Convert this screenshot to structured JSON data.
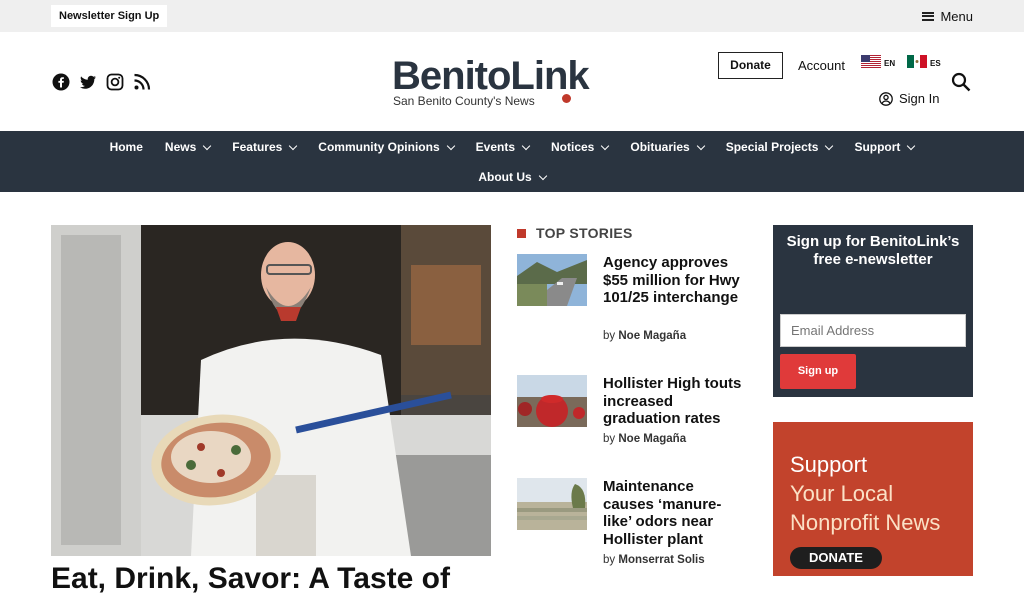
{
  "topbar": {
    "newsletter_label": "Newsletter Sign Up",
    "menu_label": "Menu"
  },
  "social": [
    "facebook-icon",
    "twitter-icon",
    "instagram-icon",
    "rss-icon"
  ],
  "logo": {
    "title": "BenitoLink",
    "tagline": "San Benito County's News"
  },
  "header": {
    "donate_label": "Donate",
    "account_label": "Account",
    "lang_en": "EN",
    "lang_es": "ES",
    "signin_label": "Sign In"
  },
  "nav": {
    "row1": [
      "Home",
      "News",
      "Features",
      "Community Opinions",
      "Events",
      "Notices",
      "Obituaries",
      "Special Projects",
      "Support"
    ],
    "row2": [
      "About Us"
    ]
  },
  "hero": {
    "headline": "Eat, Drink, Savor: A Taste of"
  },
  "top_stories": {
    "label": "TOP STORIES",
    "items": [
      {
        "title": "Agency approves $55 million for Hwy 101/25 interchange",
        "by": "by",
        "author": "Noe Magaña"
      },
      {
        "title": "Hollister High touts increased graduation rates",
        "by": "by",
        "author": "Noe Magaña"
      },
      {
        "title": "Maintenance causes ‘manure-like’ odors near Hollister plant",
        "by": "by",
        "author": "Monserrat Solis"
      }
    ]
  },
  "newsletter_box": {
    "heading": "Sign up for BenitoLink’s free e-newsletter",
    "email_placeholder": "Email Address",
    "signup_label": "Sign up"
  },
  "ad": {
    "line1": "Support",
    "line2": "Your Local",
    "line3": "Nonprofit News",
    "button": "DONATE"
  },
  "colors": {
    "navy": "#2a3440",
    "accent_red": "#c0392b",
    "signup_red": "#e03a3a",
    "ad_bg": "#c2432c"
  }
}
